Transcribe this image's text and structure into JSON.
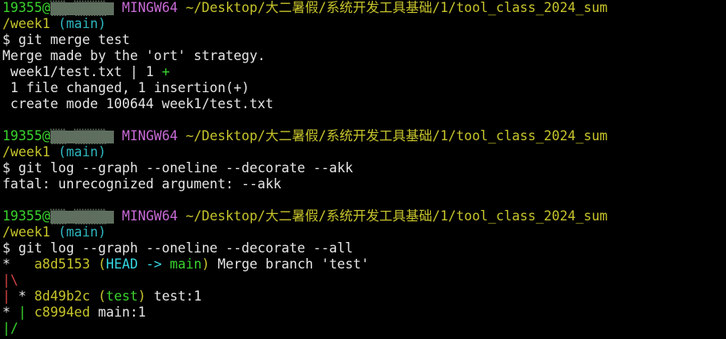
{
  "prompt": {
    "user": "19355@",
    "host_masked": "▒▒ч▒▒▒▒9",
    "system": "MINGW64",
    "path_line1": "~/Desktop/大二暑假/系统开发工具基础/1/tool_class_2024_sum",
    "path_line2": "/week1",
    "branch": "(main)",
    "symbol": "$"
  },
  "blocks": [
    {
      "command": "git merge test",
      "output": [
        "Merge made by the 'ort' strategy.",
        " week1/test.txt | 1 ",
        " 1 file changed, 1 insertion(+)",
        " create mode 100644 week1/test.txt"
      ],
      "diffstat_plus": "+"
    },
    {
      "command": "git log --graph --oneline --decorate --akk",
      "output": [
        "fatal: unrecognized argument: --akk"
      ]
    },
    {
      "command": "git log --graph --oneline --decorate --all",
      "log": [
        {
          "graph": "*   ",
          "hash": "a8d5153",
          "ref_open": "(",
          "head": "HEAD -> ",
          "branch": "main",
          "ref_close": ")",
          "msg": " Merge branch 'test'"
        },
        {
          "graph_red": "|\\"
        },
        {
          "graph_red": "| ",
          "graph": "* ",
          "hash": "8d49b2c",
          "ref_open": "(",
          "branch": "test",
          "ref_close": ")",
          "msg": " test:1"
        },
        {
          "graph": "* ",
          "graph_green": "| ",
          "hash": "c8994ed",
          "msg": " main:1"
        },
        {
          "graph_green": "|/"
        }
      ]
    }
  ]
}
